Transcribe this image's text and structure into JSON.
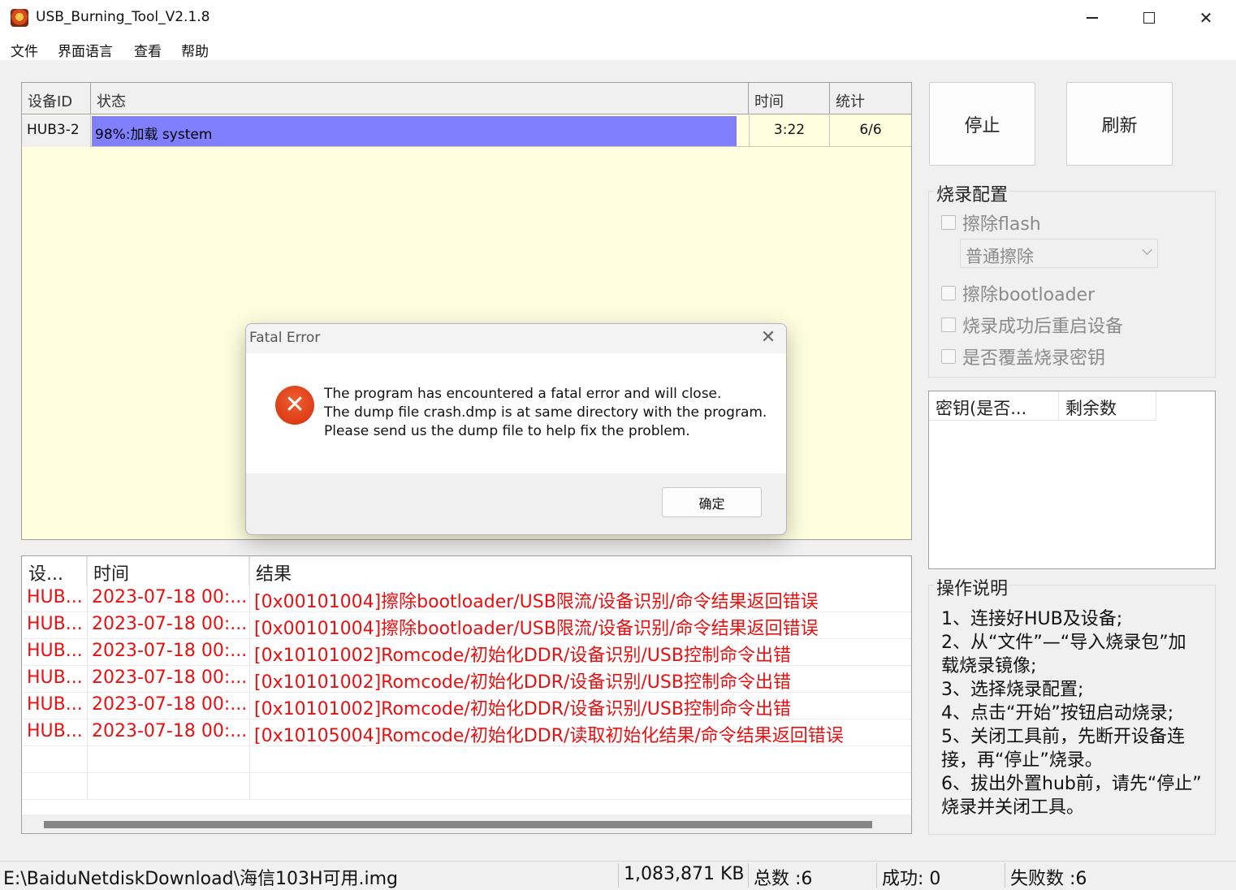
{
  "window": {
    "title": "USB_Burning_Tool_V2.1.8"
  },
  "menu": [
    "文件",
    "界面语言",
    "查看",
    "帮助"
  ],
  "device_table": {
    "headers": [
      "设备ID",
      "状态",
      "时间",
      "统计"
    ],
    "row": {
      "id": "HUB3-2",
      "status": "98%:加载 system",
      "progress": 0.98,
      "time": "3:22",
      "stat": "6/6"
    }
  },
  "buttons": {
    "stop": "停止",
    "refresh": "刷新"
  },
  "burn_config": {
    "title": "烧录配置",
    "erase_flash": "擦除flash",
    "erase_mode": "普通擦除",
    "erase_bootloader": "擦除bootloader",
    "reboot_after": "烧录成功后重启设备",
    "overwrite_key": "是否覆盖烧录密钥"
  },
  "key_table": {
    "headers": [
      "密钥(是否...",
      "剩余数"
    ]
  },
  "instructions": {
    "title": "操作说明",
    "lines": [
      "1、连接好HUB及设备;",
      "2、从“文件”—“导入烧录包”加",
      "载烧录镜像;",
      "3、选择烧录配置;",
      "4、点击“开始”按钮启动烧录;",
      "5、关闭工具前，先断开设备连",
      "接，再“停止”烧录。",
      "6、拔出外置hub前，请先“停止”",
      "烧录并关闭工具。"
    ]
  },
  "log_table": {
    "headers": [
      "设...",
      "时间",
      "结果"
    ],
    "rows": [
      {
        "dev": "HUB...",
        "time": "2023-07-18 00:...",
        "result": "[0x00101004]擦除bootloader/USB限流/设备识别/命令结果返回错误"
      },
      {
        "dev": "HUB...",
        "time": "2023-07-18 00:...",
        "result": "[0x00101004]擦除bootloader/USB限流/设备识别/命令结果返回错误"
      },
      {
        "dev": "HUB...",
        "time": "2023-07-18 00:...",
        "result": "[0x10101002]Romcode/初始化DDR/设备识别/USB控制命令出错"
      },
      {
        "dev": "HUB...",
        "time": "2023-07-18 00:...",
        "result": "[0x10101002]Romcode/初始化DDR/设备识别/USB控制命令出错"
      },
      {
        "dev": "HUB...",
        "time": "2023-07-18 00:...",
        "result": "[0x10101002]Romcode/初始化DDR/设备识别/USB控制命令出错"
      },
      {
        "dev": "HUB...",
        "time": "2023-07-18 00:...",
        "result": "[0x10105004]Romcode/初始化DDR/读取初始化结果/命令结果返回错误"
      }
    ]
  },
  "status_bar": {
    "path": "E:\\BaiduNetdiskDownload\\海信103H可用.img",
    "size": "1,083,871 KB",
    "total": "总数 :6",
    "success": "成功:  0",
    "failed": "失败数 :6"
  },
  "dialog": {
    "title": "Fatal Error",
    "lines": [
      "The program has encountered a fatal error and will close.",
      "The dump file crash.dmp is at same directory with the program.",
      "Please send us the dump file to help fix the problem."
    ],
    "ok": "确定"
  },
  "colors": {
    "progress": "#8080ff",
    "device_bg": "#ffffe0",
    "error_text": "#e81010"
  }
}
